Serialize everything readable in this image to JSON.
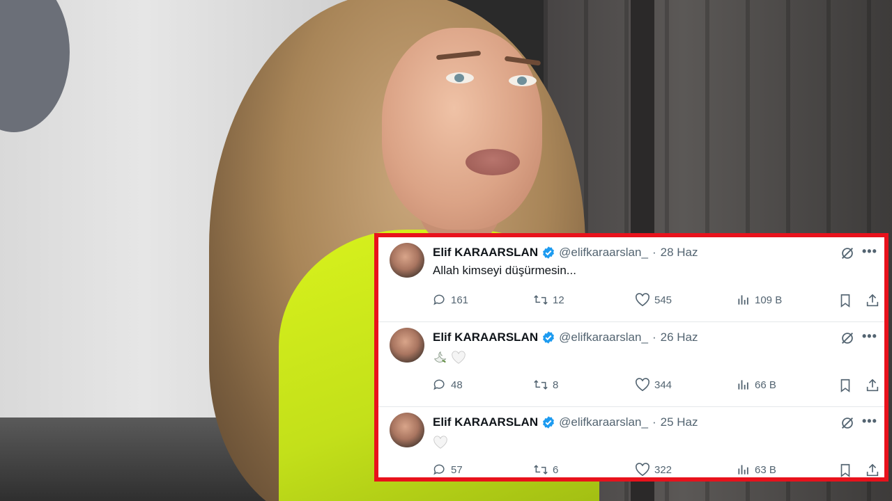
{
  "photo": {
    "description_colors": {
      "jacket": "#c8e51a",
      "frame": "#e8121c"
    }
  },
  "tweets": [
    {
      "name": "Elif KARAARSLAN",
      "handle": "@elifkaraarslan_",
      "separator": "·",
      "date": "28 Haz",
      "text": "Allah kimseyi düşürmesin...",
      "emojis": [],
      "replies": "161",
      "retweets": "12",
      "likes": "545",
      "views": "109 B"
    },
    {
      "name": "Elif KARAARSLAN",
      "handle": "@elifkaraarslan_",
      "separator": "·",
      "date": "26 Haz",
      "text": "",
      "emojis": [
        "dove-icon",
        "white-heart-icon"
      ],
      "replies": "48",
      "retweets": "8",
      "likes": "344",
      "views": "66 B"
    },
    {
      "name": "Elif KARAARSLAN",
      "handle": "@elifkaraarslan_",
      "separator": "·",
      "date": "25 Haz",
      "text": "",
      "emojis": [
        "white-heart-icon"
      ],
      "replies": "57",
      "retweets": "6",
      "likes": "322",
      "views": "63 B"
    }
  ],
  "colors": {
    "verified": "#1d9bf0",
    "muted": "#536471",
    "text": "#0f1419"
  }
}
